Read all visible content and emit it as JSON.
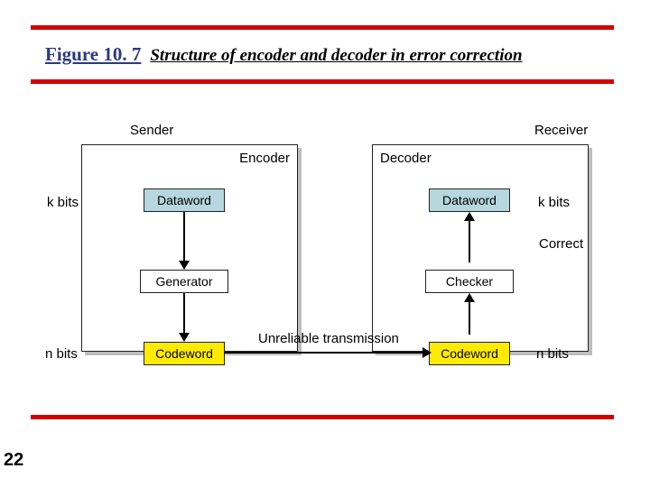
{
  "title": {
    "figure_label": "Figure 10. 7",
    "caption": "Structure of encoder and decoder in error correction"
  },
  "page_number": "22",
  "diagram": {
    "sender_label": "Sender",
    "receiver_label": "Receiver",
    "encoder_label": "Encoder",
    "decoder_label": "Decoder",
    "k_bits": "k bits",
    "n_bits": "n bits",
    "dataword": "Dataword",
    "generator": "Generator",
    "codeword": "Codeword",
    "checker": "Checker",
    "correct_label": "Correct",
    "transmission_label": "Unreliable transmission"
  }
}
